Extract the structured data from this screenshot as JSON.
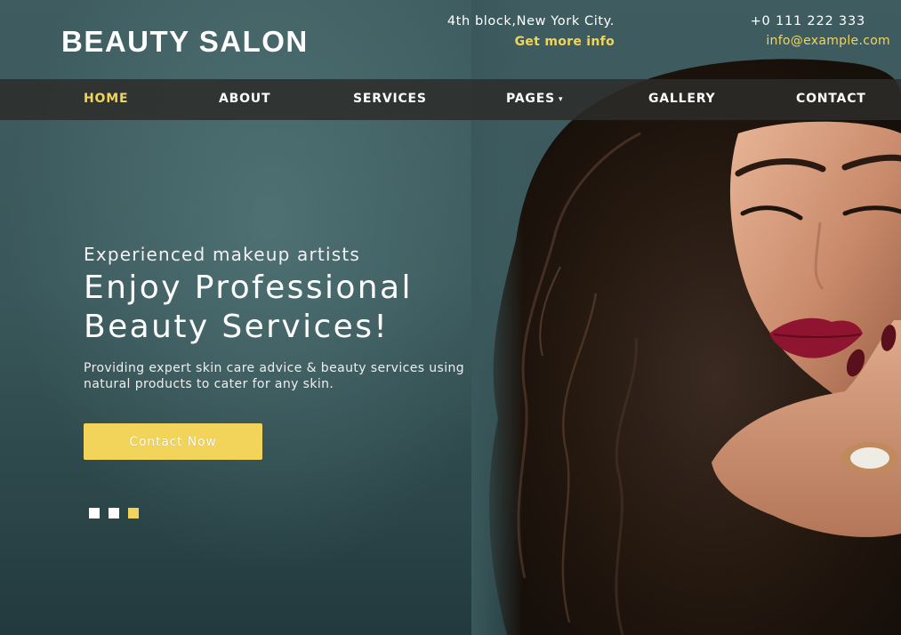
{
  "brand": {
    "logo": "BEAUTY SALON"
  },
  "header": {
    "address": "4th block,New York City.",
    "more_info": "Get more info",
    "phone": "+0 111 222 333",
    "email": "info@example.com"
  },
  "nav": {
    "items": [
      {
        "label": "HOME",
        "active": true
      },
      {
        "label": "ABOUT"
      },
      {
        "label": "SERVICES"
      },
      {
        "label": "PAGES",
        "has_dropdown": true
      },
      {
        "label": "GALLERY"
      },
      {
        "label": "CONTACT"
      }
    ],
    "dropdown_icon": "▾"
  },
  "hero": {
    "tagline": "Experienced makeup artists",
    "headline": "Enjoy Professional Beauty Services!",
    "description": "Providing expert skin care advice & beauty services using natural products to cater for any skin.",
    "cta_label": "Contact Now",
    "slides": {
      "count": 3,
      "active_index": 2
    },
    "image": "portrait-photo"
  },
  "colors": {
    "accent": "#f2d45b",
    "nav_background": "#2c2c2a",
    "hero_background": "#3a585b",
    "text": "#ffffff"
  }
}
